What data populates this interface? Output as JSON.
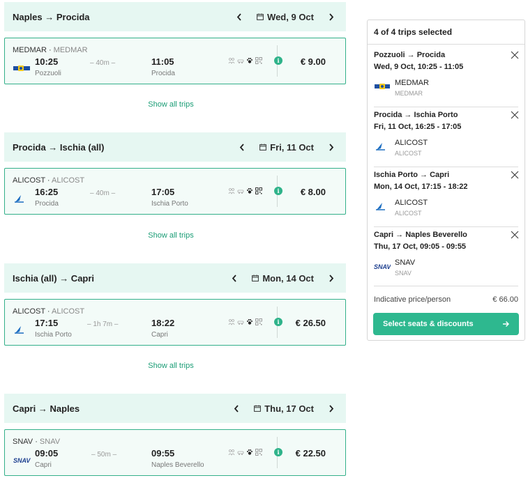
{
  "legs": [
    {
      "route": "Naples → Procida",
      "date": "Wed, 9 Oct",
      "operator": "MEDMAR",
      "operator_sub": "MEDMAR",
      "logo": "medmar-logo",
      "dep_time": "10:25",
      "dep_port": "Pozzuoli",
      "duration": "– 40m –",
      "arr_time": "11:05",
      "arr_port": "Procida",
      "price": "€ 9.00",
      "show_all": "Show all trips"
    },
    {
      "route": "Procida → Ischia (all)",
      "date": "Fri, 11 Oct",
      "operator": "ALICOST",
      "operator_sub": "ALICOST",
      "logo": "alicost-logo",
      "dep_time": "16:25",
      "dep_port": "Procida",
      "duration": "– 40m –",
      "arr_time": "17:05",
      "arr_port": "Ischia Porto",
      "price": "€ 8.00",
      "show_all": "Show all trips"
    },
    {
      "route": "Ischia (all) → Capri",
      "date": "Mon, 14 Oct",
      "operator": "ALICOST",
      "operator_sub": "ALICOST",
      "logo": "alicost-logo",
      "dep_time": "17:15",
      "dep_port": "Ischia Porto",
      "duration": "– 1h 7m –",
      "arr_time": "18:22",
      "arr_port": "Capri",
      "price": "€ 26.50",
      "show_all": "Show all trips"
    },
    {
      "route": "Capri → Naples",
      "date": "Thu, 17 Oct",
      "operator": "SNAV",
      "operator_sub": "SNAV",
      "logo": "snav-logo",
      "dep_time": "09:05",
      "dep_port": "Capri",
      "duration": "– 50m –",
      "arr_time": "09:55",
      "arr_port": "Naples Beverello",
      "price": "€ 22.50"
    }
  ],
  "amenity_icons": [
    "passengers-icon",
    "vehicle-icon",
    "pets-icon",
    "qr-ticket-icon",
    "info-icon"
  ],
  "panel": {
    "title": "4 of 4 trips selected",
    "items": [
      {
        "route": "Pozzuoli → Procida",
        "datetime": "Wed, 9 Oct, 10:25 - 11:05",
        "operator": "MEDMAR",
        "operator_sub": "MEDMAR"
      },
      {
        "route": "Procida → Ischia Porto",
        "datetime": "Fri, 11 Oct, 16:25 - 17:05",
        "operator": "ALICOST",
        "operator_sub": "ALICOST"
      },
      {
        "route": "Ischia Porto → Capri",
        "datetime": "Mon, 14 Oct, 17:15 - 18:22",
        "operator": "ALICOST",
        "operator_sub": "ALICOST"
      },
      {
        "route": "Capri → Naples Beverello",
        "datetime": "Thu, 17 Oct, 09:05 - 09:55",
        "operator": "SNAV",
        "operator_sub": "SNAV"
      }
    ],
    "total_label": "Indicative price/person",
    "total_value": "€ 66.00",
    "cta_label": "Select seats & discounts"
  },
  "colors": {
    "accent": "#2eb88f",
    "header_bg": "#e6f7f2",
    "card_border": "#33b08a",
    "link": "#1b9d76"
  }
}
